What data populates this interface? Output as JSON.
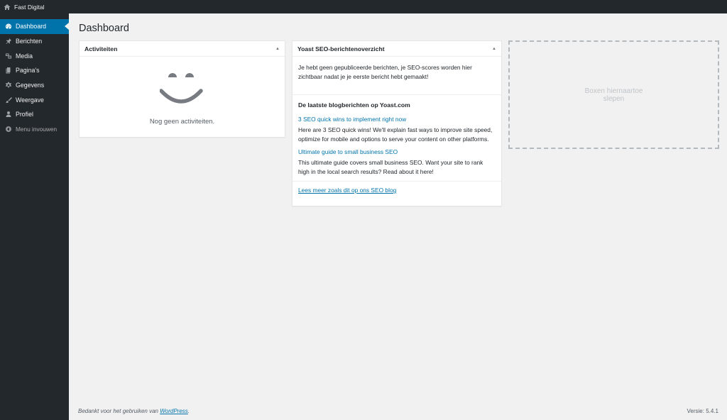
{
  "adminbar": {
    "site_name": "Fast Digital"
  },
  "sidebar": {
    "items": [
      {
        "label": "Dashboard",
        "icon": "gauge-icon",
        "active": true
      },
      {
        "label": "Berichten",
        "icon": "pin-icon"
      },
      {
        "label": "Media",
        "icon": "media-icon"
      },
      {
        "label": "Pagina's",
        "icon": "pages-icon"
      },
      {
        "label": "Gegevens",
        "icon": "gear-icon"
      },
      {
        "label": "Weergave",
        "icon": "brush-icon"
      },
      {
        "label": "Profiel",
        "icon": "user-icon"
      }
    ],
    "collapse_label": "Menu invouwen"
  },
  "page": {
    "title": "Dashboard"
  },
  "activity": {
    "title": "Activiteiten",
    "empty_text": "Nog geen activiteiten."
  },
  "yoast": {
    "title": "Yoast SEO-berichtenoverzicht",
    "intro": "Je hebt geen gepubliceerde berichten, je SEO-scores worden hier zichtbaar nadat je je eerste bericht hebt gemaakt!",
    "feed_title": "De laatste blogberichten op Yoast.com",
    "posts": [
      {
        "title": "3 SEO quick wins to implement right now",
        "excerpt": "Here are 3 SEO quick wins! We'll explain fast ways to improve site speed, optimize for mobile and options to serve your content on other platforms."
      },
      {
        "title": "Ultimate guide to small business SEO",
        "excerpt": "This ultimate guide covers small business SEO. Want your site to rank high in the local search results? Read about it here!"
      }
    ],
    "read_more": "Lees meer zoals dit op ons SEO blog"
  },
  "dropzone": {
    "text": "Boxen hiernaartoe slepen"
  },
  "footer": {
    "thanks_prefix": "Bedankt voor het gebruiken van",
    "wordpress_link": "WordPress",
    "thanks_suffix": ".",
    "version": "Versie: 5.4.1"
  },
  "colors": {
    "admin_dark": "#23282d",
    "accent": "#0073aa",
    "background": "#f1f1f1"
  }
}
